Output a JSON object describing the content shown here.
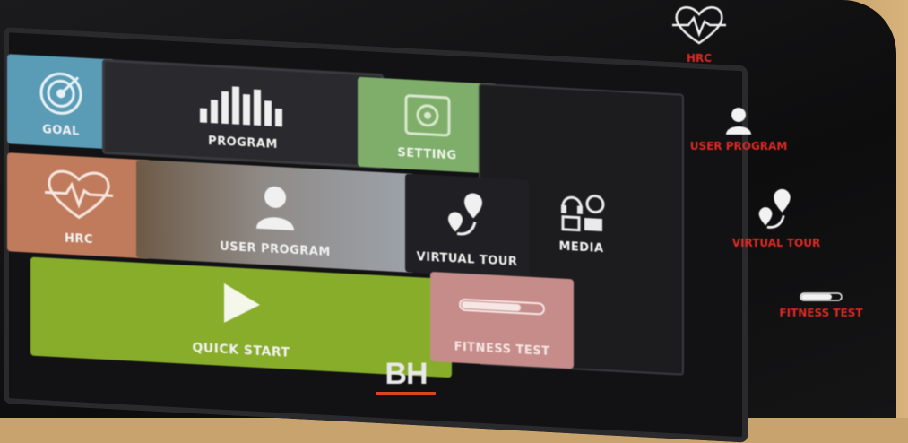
{
  "screen": {
    "tiles": {
      "goal": "GOAL",
      "program": "PROGRAM",
      "setting": "SETTING",
      "hrc": "HRC",
      "user_program": "USER PROGRAM",
      "virtual_tour": "VIRTUAL TOUR",
      "media": "MEDIA",
      "quick_start": "QUICK START",
      "fitness_test": "FITNESS TEST"
    },
    "logo": "BH"
  },
  "side_panel": {
    "items": [
      "HRC",
      "USER PROGRAM",
      "VIRTUAL TOUR",
      "FITNESS TEST"
    ]
  },
  "colors": {
    "goal": "#5a9bb6",
    "setting": "#7eae6a",
    "hrc": "#c07b5c",
    "quick_start": "#87ad2a",
    "fitness_test": "#c58c89",
    "side_label": "#e02a24",
    "logo_accent": "#d8451f"
  },
  "icons": {
    "goal": "target-icon",
    "program": "bar-chart-icon",
    "setting": "settings-icon",
    "hrc": "heart-pulse-icon",
    "user_program": "user-icon",
    "virtual_tour": "map-pin-route-icon",
    "media": "media-icon",
    "quick_start": "play-icon",
    "fitness_test": "progress-bar-icon"
  }
}
